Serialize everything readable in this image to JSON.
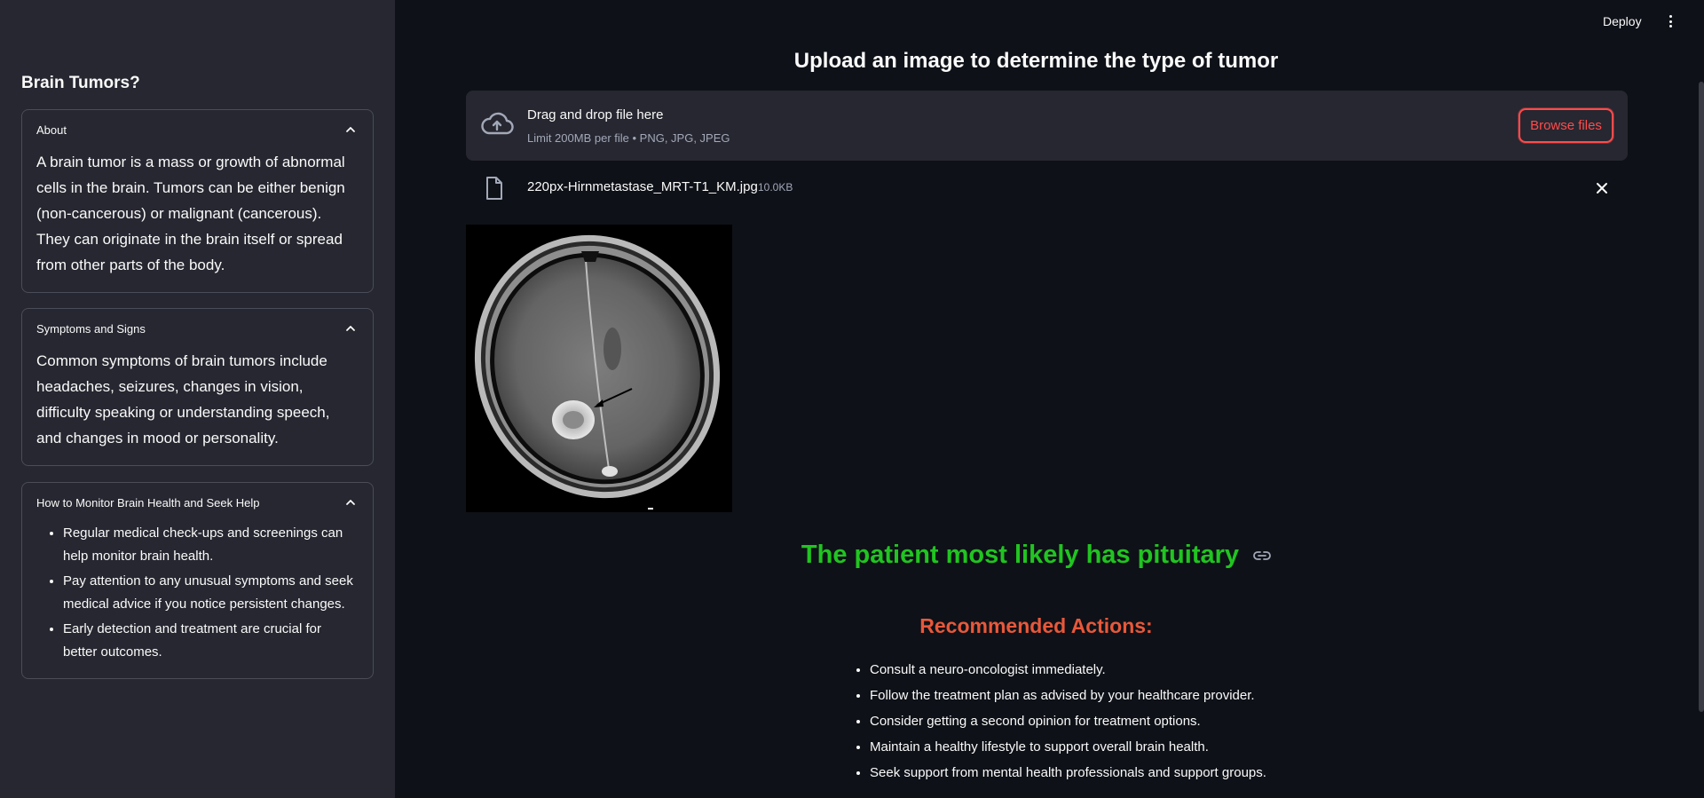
{
  "sidebar": {
    "title": "Brain Tumors?",
    "sections": [
      {
        "header": "About",
        "body": "A brain tumor is a mass or growth of abnormal cells in the brain. Tumors can be either benign (non-cancerous) or malignant (cancerous). They can originate in the brain itself or spread from other parts of the body."
      },
      {
        "header": "Symptoms and Signs",
        "body": "Common symptoms of brain tumors include headaches, seizures, changes in vision, difficulty speaking or understanding speech, and changes in mood or personality."
      },
      {
        "header": "How to Monitor Brain Health and Seek Help",
        "items": [
          "Regular medical check-ups and screenings can help monitor brain health.",
          "Pay attention to any unusual symptoms and seek medical advice if you notice persistent changes.",
          "Early detection and treatment are crucial for better outcomes."
        ]
      }
    ]
  },
  "toolbar": {
    "deploy_label": "Deploy"
  },
  "main": {
    "title": "Upload an image to determine the type of tumor",
    "uploader": {
      "title": "Drag and drop file here",
      "subtitle": "Limit 200MB per file • PNG, JPG, JPEG",
      "browse_label": "Browse files"
    },
    "file": {
      "name": "220px-Hirnmetastase_MRT-T1_KM.jpg",
      "size": "10.0KB"
    },
    "result": "The patient most likely has pituitary",
    "recommended_title": "Recommended Actions:",
    "recommended": [
      "Consult a neuro-oncologist immediately.",
      "Follow the treatment plan as advised by your healthcare provider.",
      "Consider getting a second opinion for treatment options.",
      "Maintain a healthy lifestyle to support overall brain health.",
      "Seek support from mental health professionals and support groups."
    ]
  },
  "colors": {
    "background": "#0e1117",
    "sidebar": "#262730",
    "accent": "#ff4b4b",
    "result": "#21c421",
    "recommended": "#e8583a"
  }
}
